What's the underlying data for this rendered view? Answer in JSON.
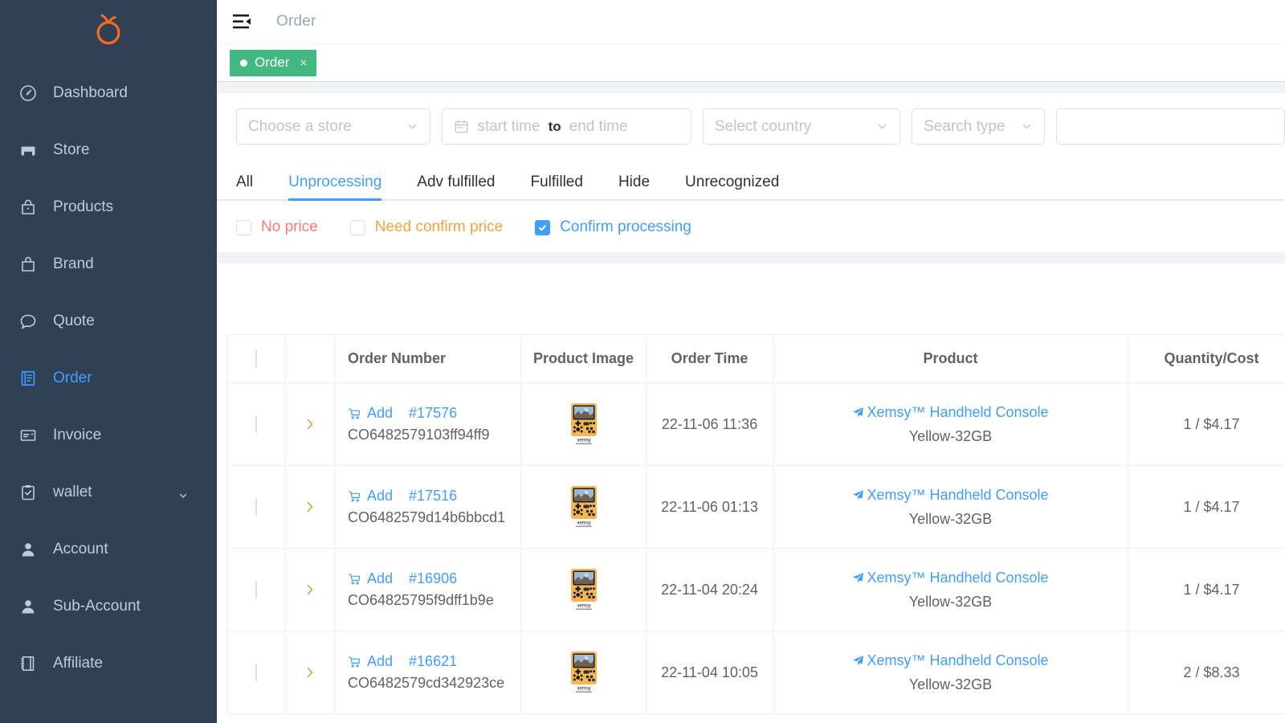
{
  "brand": {
    "logo_icon": "orange-fruit-logo",
    "color": "#f56c20"
  },
  "sidebar": {
    "items": [
      {
        "label": "Dashboard",
        "icon": "dashboard-gauge-icon",
        "active": false,
        "expandable": false
      },
      {
        "label": "Store",
        "icon": "store-icon",
        "active": false,
        "expandable": false
      },
      {
        "label": "Products",
        "icon": "products-bag-icon",
        "active": false,
        "expandable": false
      },
      {
        "label": "Brand",
        "icon": "brand-bag-icon",
        "active": false,
        "expandable": false
      },
      {
        "label": "Quote",
        "icon": "quote-chat-icon",
        "active": false,
        "expandable": false
      },
      {
        "label": "Order",
        "icon": "order-book-icon",
        "active": true,
        "expandable": false
      },
      {
        "label": "Invoice",
        "icon": "invoice-icon",
        "active": false,
        "expandable": false
      },
      {
        "label": "wallet",
        "icon": "wallet-clipboard-icon",
        "active": false,
        "expandable": true
      },
      {
        "label": "Account",
        "icon": "account-user-icon",
        "active": false,
        "expandable": false
      },
      {
        "label": "Sub-Account",
        "icon": "sub-account-user-icon",
        "active": false,
        "expandable": false
      },
      {
        "label": "Affiliate",
        "icon": "affiliate-book-icon",
        "active": false,
        "expandable": false
      }
    ]
  },
  "topbar": {
    "fold_icon": "menu-fold-icon",
    "breadcrumb": "Order"
  },
  "tabs_bar": {
    "chip_label": "Order",
    "chip_close": "×",
    "chip_color": "#42b983"
  },
  "filters": {
    "store": {
      "placeholder": "Choose a store",
      "value": ""
    },
    "date_range": {
      "start_placeholder": "start time",
      "separator": "to",
      "end_placeholder": "end time",
      "icon": "calendar-icon"
    },
    "country": {
      "placeholder": "Select country",
      "value": ""
    },
    "search_type": {
      "placeholder": "Search type",
      "value": ""
    },
    "search_input": {
      "placeholder": "",
      "value": ""
    }
  },
  "status_tabs": {
    "items": [
      {
        "label": "All",
        "active": false
      },
      {
        "label": "Unprocessing",
        "active": true
      },
      {
        "label": "Adv fulfilled",
        "active": false
      },
      {
        "label": "Fulfilled",
        "active": false
      },
      {
        "label": "Hide",
        "active": false
      },
      {
        "label": "Unrecognized",
        "active": false
      }
    ],
    "active_color": "#409eff"
  },
  "checkbox_filters": [
    {
      "label": "No price",
      "checked": false,
      "color": "#ff7875"
    },
    {
      "label": "Need confirm price",
      "checked": false,
      "color": "#faa043"
    },
    {
      "label": "Confirm processing",
      "checked": true,
      "color": "#409eff"
    }
  ],
  "table": {
    "select_all_checked": false,
    "columns": [
      {
        "key": "select",
        "label": ""
      },
      {
        "key": "expand",
        "label": ""
      },
      {
        "key": "order_number",
        "label": "Order Number"
      },
      {
        "key": "product_image",
        "label": "Product Image"
      },
      {
        "key": "order_time",
        "label": "Order Time"
      },
      {
        "key": "product",
        "label": "Product"
      },
      {
        "key": "quantity_cost",
        "label": "Quantity/Cost"
      }
    ],
    "add_label": "Add",
    "rows": [
      {
        "selected": false,
        "order_id": "#17576",
        "order_code": "CO6482579103ff94ff9",
        "order_time": "22-11-06 11:36",
        "product_name": "Xemsy™ Handheld Console",
        "product_variant": "Yellow-32GB",
        "quantity_cost": "1 / $4.17"
      },
      {
        "selected": false,
        "order_id": "#17516",
        "order_code": "CO6482579d14b6bbcd1",
        "order_time": "22-11-06 01:13",
        "product_name": "Xemsy™ Handheld Console",
        "product_variant": "Yellow-32GB",
        "quantity_cost": "1 / $4.17"
      },
      {
        "selected": false,
        "order_id": "#16906",
        "order_code": "CO64825795f9dff1b9e",
        "order_time": "22-11-04 20:24",
        "product_name": "Xemsy™ Handheld Console",
        "product_variant": "Yellow-32GB",
        "quantity_cost": "1 / $4.17"
      },
      {
        "selected": false,
        "order_id": "#16621",
        "order_code": "CO6482579cd342923ce",
        "order_time": "22-11-04 10:05",
        "product_name": "Xemsy™ Handheld Console",
        "product_variant": "Yellow-32GB",
        "quantity_cost": "2 / $8.33"
      }
    ],
    "thumbnail_caption": "xemsy"
  }
}
